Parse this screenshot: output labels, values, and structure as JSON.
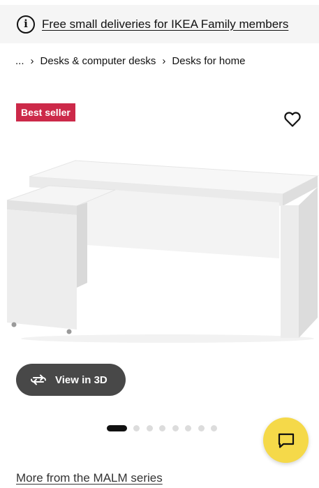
{
  "banner": {
    "icon": "info-icon",
    "icon_glyph": "i",
    "text": "Free small deliveries for IKEA Family members"
  },
  "breadcrumb": {
    "ellipsis": "...",
    "separator": "›",
    "items": [
      "Desks & computer desks",
      "Desks for home"
    ]
  },
  "product": {
    "badge": "Best seller",
    "badge_color": "#cc2949",
    "favourite_icon": "heart-icon",
    "image": "white-desk-with-pull-out-panel",
    "view3d_label": "View in 3D",
    "view3d_icon": "rotate-icon"
  },
  "carousel": {
    "total": 8,
    "active_index": 0
  },
  "chat": {
    "icon": "chat-icon",
    "color": "#f5d949"
  },
  "series_link": "More from the MALM series"
}
